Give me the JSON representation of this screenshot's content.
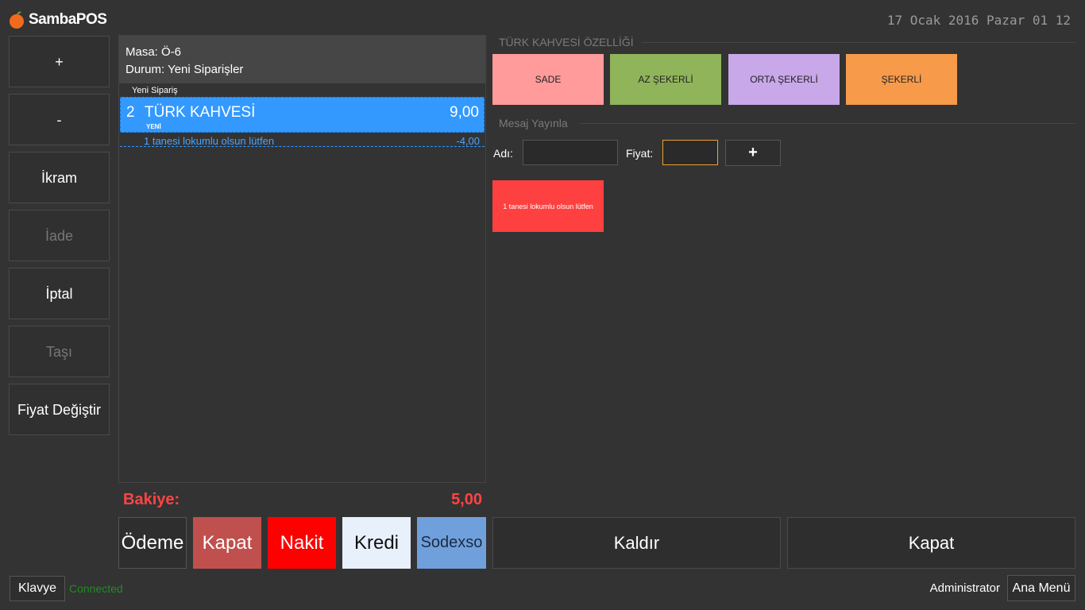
{
  "header": {
    "app_title": "SambaPOS",
    "logo_icon": "orange-fruit-icon",
    "datetime": "17 Ocak 2016 Pazar 01 12"
  },
  "commands": [
    {
      "label": "+",
      "enabled": true
    },
    {
      "label": "-",
      "enabled": true
    },
    {
      "label": "İkram",
      "enabled": true
    },
    {
      "label": "İade",
      "enabled": false
    },
    {
      "label": "İptal",
      "enabled": true
    },
    {
      "label": "Taşı",
      "enabled": false
    },
    {
      "label": "Fiyat Değiştir",
      "enabled": true
    }
  ],
  "ticket": {
    "table": "Masa: Ö-6",
    "status": "Durum: Yeni Siparişler",
    "order_group": "Yeni Sipariş",
    "order": {
      "qty": "2",
      "name": "TÜRK KAHVESİ",
      "state": "YENİ",
      "price": "9,00"
    },
    "note": {
      "text": "1 tanesi lokumlu olsun lütfen",
      "price": "-4,00"
    },
    "balance_label": "Bakiye:",
    "balance_value": "5,00"
  },
  "payment_buttons": {
    "odeme": "Ödeme",
    "kapat": "Kapat",
    "nakit": "Nakit",
    "kredi": "Kredi",
    "sodexso": "Sodexso"
  },
  "actions": {
    "remove": "Kaldır",
    "close": "Kapat"
  },
  "tags": {
    "section_title": "TÜRK KAHVESİ ÖZELLİĞİ",
    "items": [
      "SADE",
      "AZ ŞEKERLİ",
      "ORTA ŞEKERLİ",
      "ŞEKERLİ"
    ],
    "colors": [
      "#ff9b9b",
      "#8fb45a",
      "#c8a8e8",
      "#f79a4a"
    ]
  },
  "broadcast": {
    "section_title": "Mesaj Yayınla",
    "name_label": "Adı:",
    "name_value": "",
    "price_label": "Fiyat:",
    "price_value": "",
    "add_label": "+",
    "message_tile": "1 tanesi lokumlu olsun lütfen"
  },
  "footer": {
    "keyboard": "Klavye",
    "connection": "Connected",
    "user": "Administrator",
    "main_menu": "Ana Menü"
  }
}
